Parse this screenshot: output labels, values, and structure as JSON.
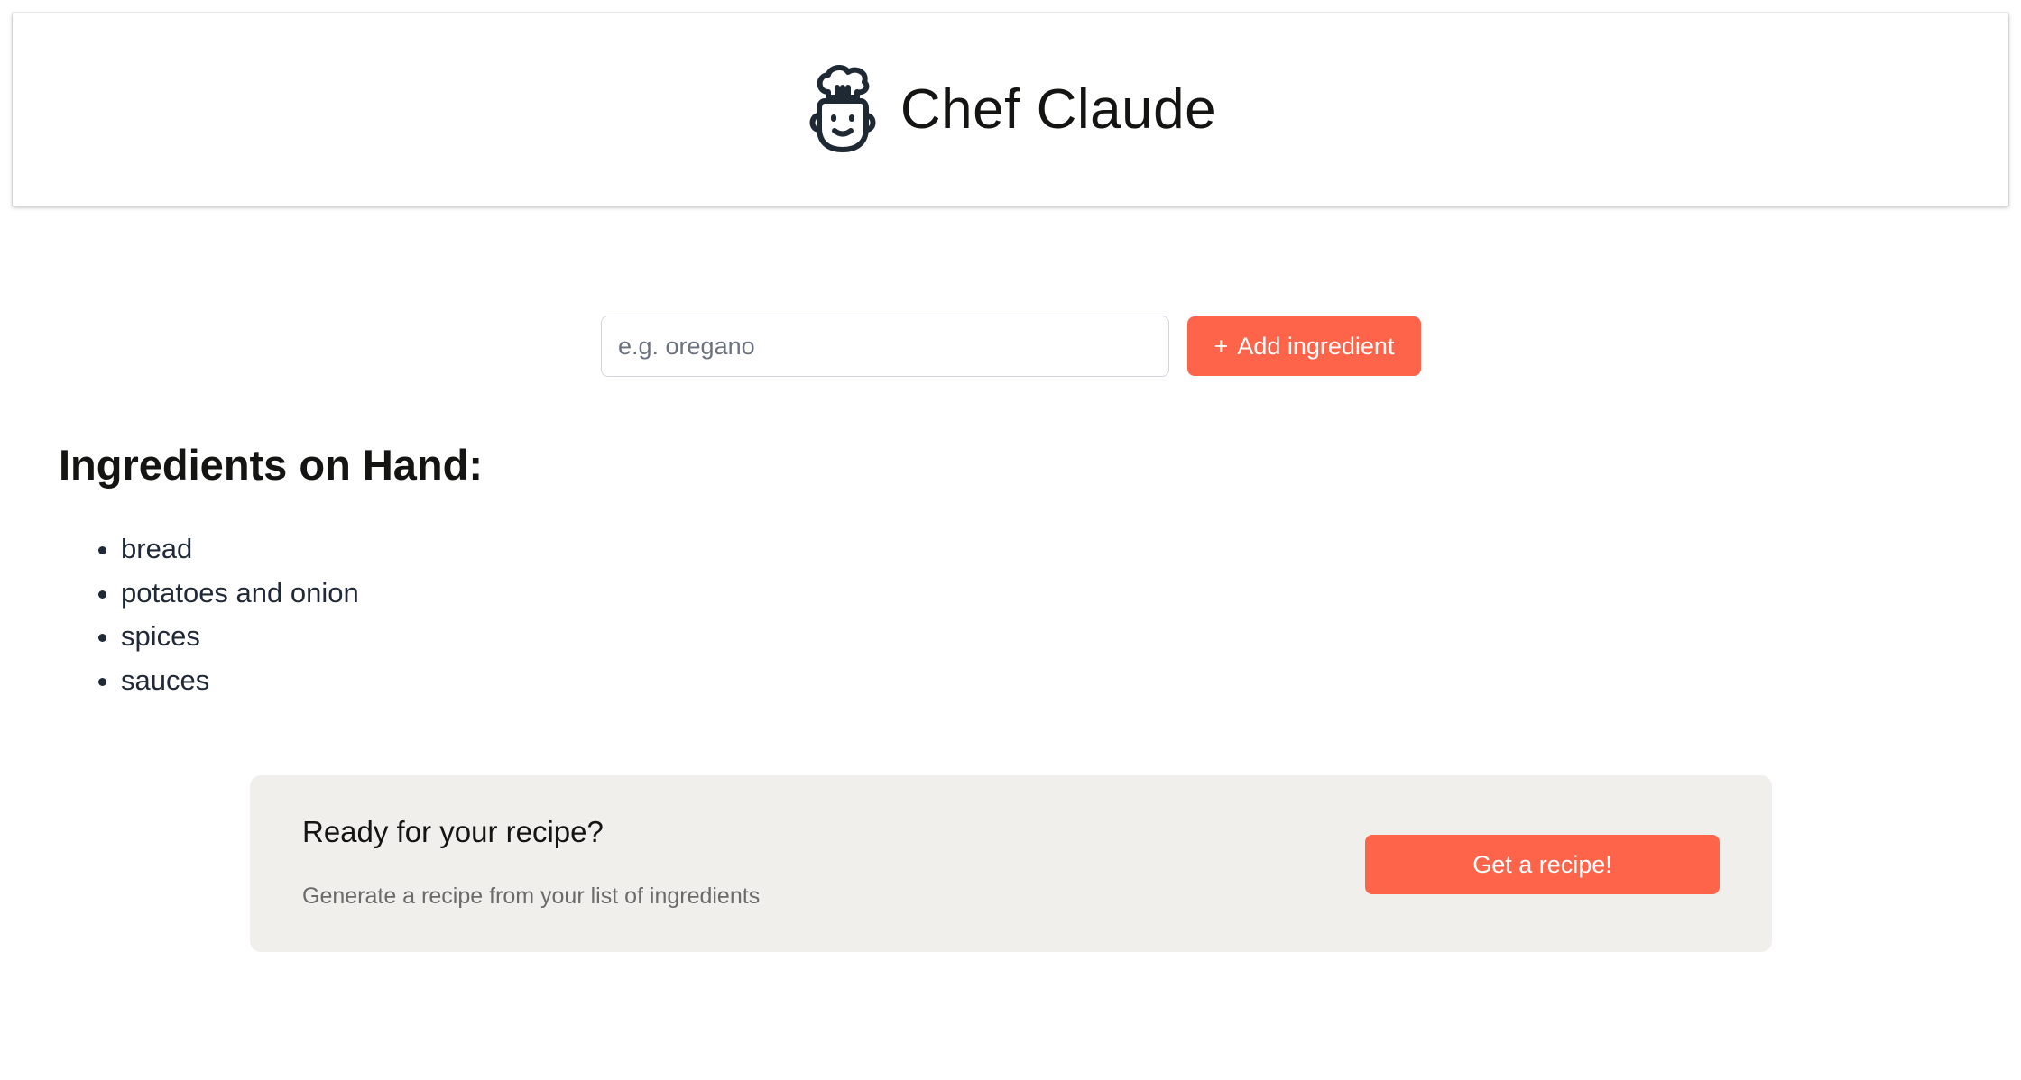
{
  "header": {
    "title": "Chef Claude",
    "logo_icon": "chef-face-icon"
  },
  "form": {
    "placeholder": "e.g. oregano",
    "value": "",
    "add_button_icon": "+",
    "add_button_label": "Add ingredient"
  },
  "ingredients": {
    "heading": "Ingredients on Hand:",
    "items": [
      "bread",
      "potatoes and onion",
      "spices",
      "sauces"
    ]
  },
  "cta": {
    "title": "Ready for your recipe?",
    "subtitle": "Generate a recipe from your list of ingredients",
    "button_label": "Get a recipe!"
  },
  "colors": {
    "accent": "#fe644a",
    "panel": "#f0efeb",
    "text": "#141413"
  }
}
